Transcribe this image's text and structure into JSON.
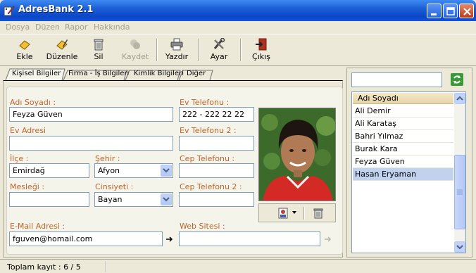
{
  "window": {
    "title": "AdresBank 2.1"
  },
  "menu": [
    "Dosya",
    "Düzen",
    "Rapor",
    "Hakkında"
  ],
  "toolbar": {
    "ekle": "Ekle",
    "duzenle": "Düzenle",
    "sil": "Sil",
    "kaydet": "Kaydet",
    "yazdir": "Yazdır",
    "ayar": "Ayar",
    "cikis": "Çıkış"
  },
  "tabs": [
    "Kişisel Bilgiler",
    "Firma - İş Bilgileri",
    "Kimlik Bilgileri",
    "Diğer"
  ],
  "form": {
    "adi_soyadi_label": "Adı Soyadı :",
    "adi_soyadi_value": "Feyza Güven",
    "ev_adresi_label": "Ev Adresi",
    "ev_adresi_value": "",
    "ilce_label": "İlçe :",
    "ilce_value": "Emirdağ",
    "sehir_label": "Şehir :",
    "sehir_value": "Afyon",
    "meslegi_label": "Mesleği :",
    "meslegi_value": "",
    "cinsiyeti_label": "Cinsiyeti :",
    "cinsiyeti_value": "Bayan",
    "email_label": "E-Mail Adresi :",
    "email_value": "fguven@homail.com",
    "ev_tel_label": "Ev Telefonu :",
    "ev_tel_value": "222 - 222 22 22",
    "ev_tel2_label": "Ev Telefonu 2 :",
    "ev_tel2_value": "",
    "cep_tel_label": "Cep Telefonu :",
    "cep_tel_value": "",
    "cep_tel2_label": "Cep Telefonu 2 :",
    "cep_tel2_value": "",
    "web_label": "Web Sitesi :",
    "web_value": ""
  },
  "list": {
    "search_value": "",
    "header": "Adı Soyadı",
    "rows": [
      "Ali Demir",
      "Ali Karataş",
      "Bahri Yılmaz",
      "Burak Kara",
      "Feyza Güven",
      "Hasan Eryaman"
    ],
    "selected": "Hasan Eryaman"
  },
  "status": {
    "text": "Toplam kayıt : 6 / 5"
  },
  "colors": {
    "label": "#c0632a",
    "title_bar": "#0a46c8",
    "selection": "#c1d2ee"
  }
}
